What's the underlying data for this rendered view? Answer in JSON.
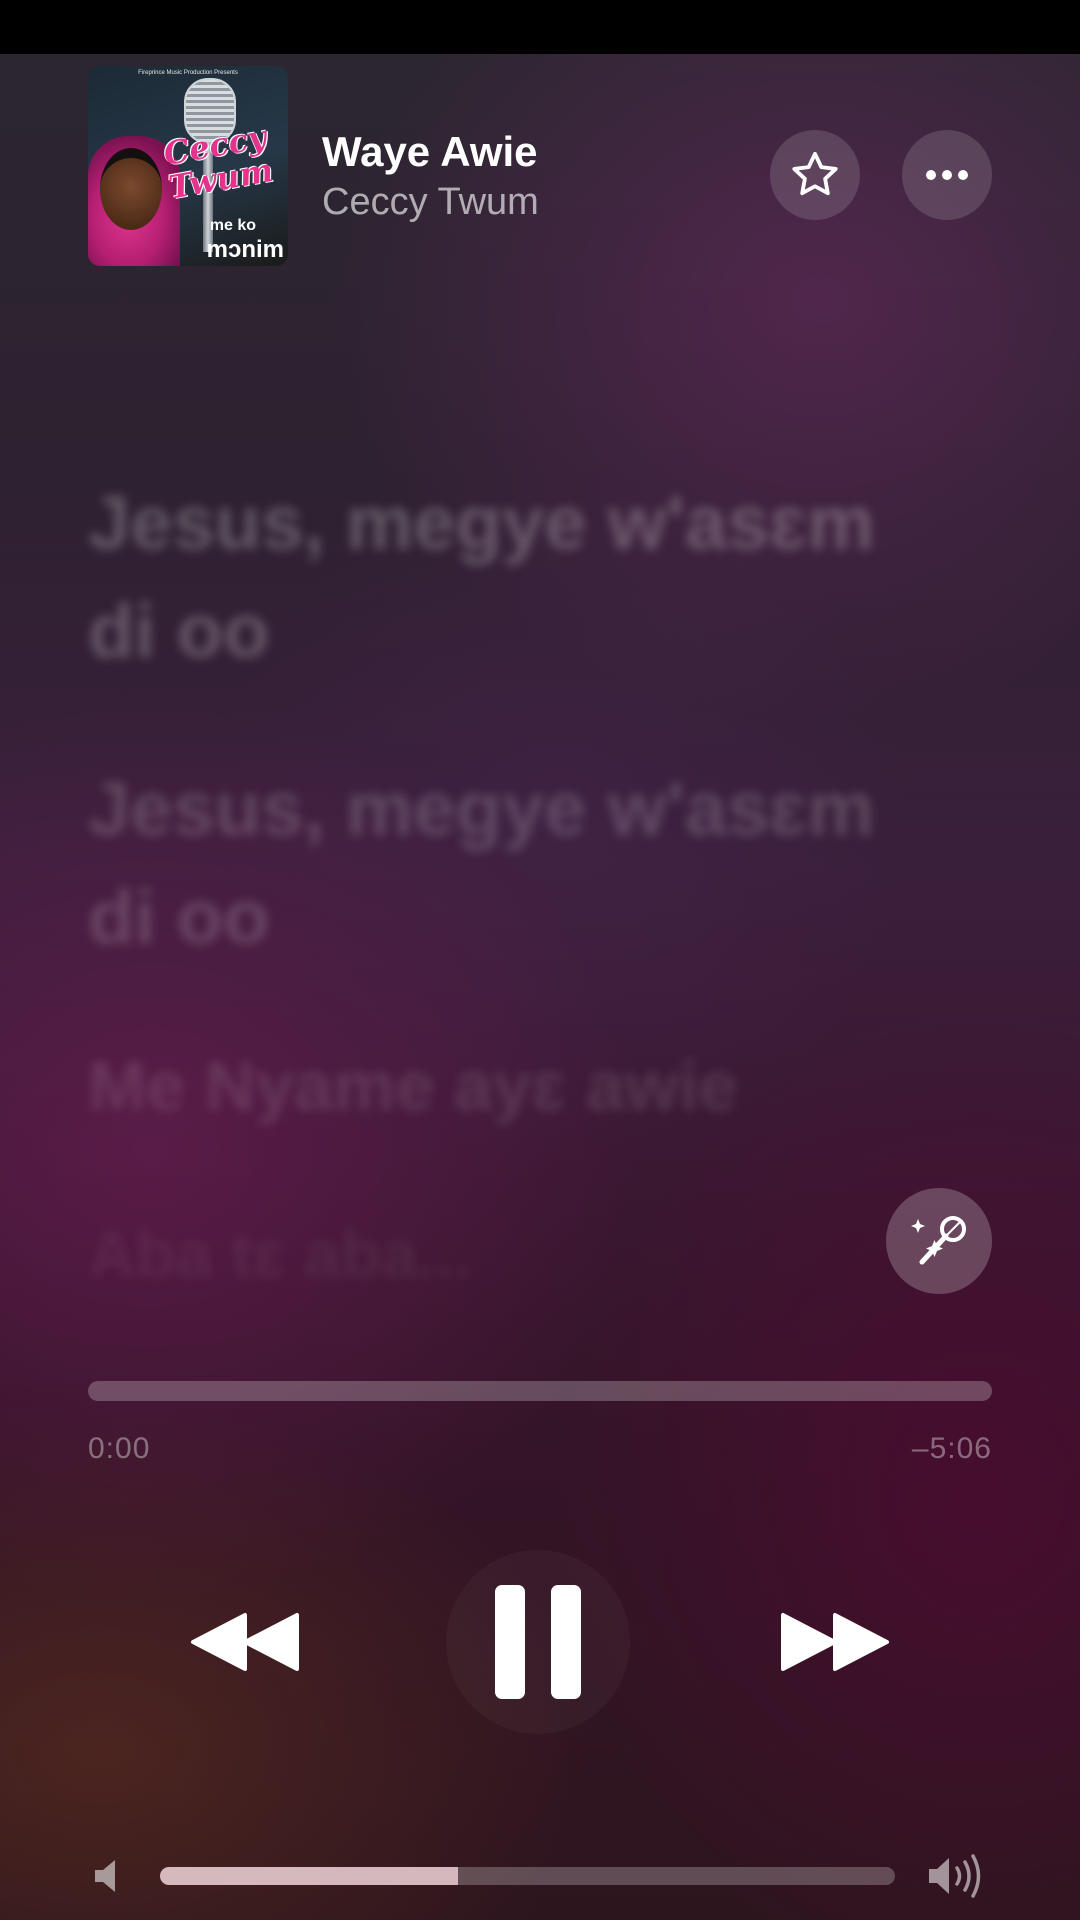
{
  "now_playing": {
    "title": "Waye Awie",
    "artist": "Ceccy Twum",
    "artwork": {
      "label_top": "Fireprince Music Production Presents",
      "title": "Ceccy Twum",
      "subtitle_small": "me ko",
      "subtitle": "mɔnim",
      "accent_color": "#e4338d"
    }
  },
  "actions": {
    "favorite_icon": "star-icon",
    "more_icon": "ellipsis-icon",
    "sing_icon": "microphone-sparkle-icon"
  },
  "lyrics": [
    "Jesus, megye w'asɛm di oo",
    "Jesus, megye w'asɛm di oo",
    "Me Nyame ayɛ awie",
    "Aba tɛ aba..."
  ],
  "playback": {
    "elapsed": "0:00",
    "remaining": "–5:06",
    "progress": 0.0,
    "state": "playing",
    "controls": [
      "rewind-icon",
      "pause-icon",
      "fast-forward-icon"
    ]
  },
  "volume": {
    "level": 0.405,
    "low_icon": "speaker-low-icon",
    "high_icon": "speaker-high-icon"
  },
  "colors": {
    "background_top": "#2b2730",
    "background_mid": "#3a1f3b",
    "background_bottom": "#2d151e",
    "status_bar": "#000000"
  }
}
